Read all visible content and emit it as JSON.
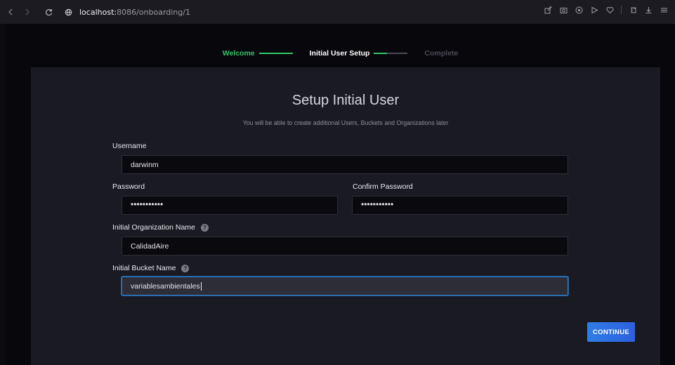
{
  "browser": {
    "url_host": "localhost:",
    "url_rest": "8086/onboarding/1"
  },
  "stepper": {
    "steps": [
      {
        "label": "Welcome",
        "state": "done"
      },
      {
        "label": "Initial User Setup",
        "state": "active"
      },
      {
        "label": "Complete",
        "state": "pending"
      }
    ],
    "colors": {
      "done": "#34c46a",
      "active": "#ffffff",
      "pending": "#4b4b55"
    }
  },
  "form": {
    "title": "Setup Initial User",
    "subtitle": "You will be able to create additional Users, Buckets and Organizations later",
    "username": {
      "label": "Username",
      "value": "darwinm"
    },
    "password": {
      "label": "Password",
      "value": "•••••••••••"
    },
    "confirm_password": {
      "label": "Confirm Password",
      "value": "•••••••••••"
    },
    "org": {
      "label": "Initial Organization Name",
      "value": "CalidadAire"
    },
    "bucket": {
      "label": "Initial Bucket Name",
      "value": "variablesambientales"
    },
    "continue_label": "CONTINUE"
  }
}
